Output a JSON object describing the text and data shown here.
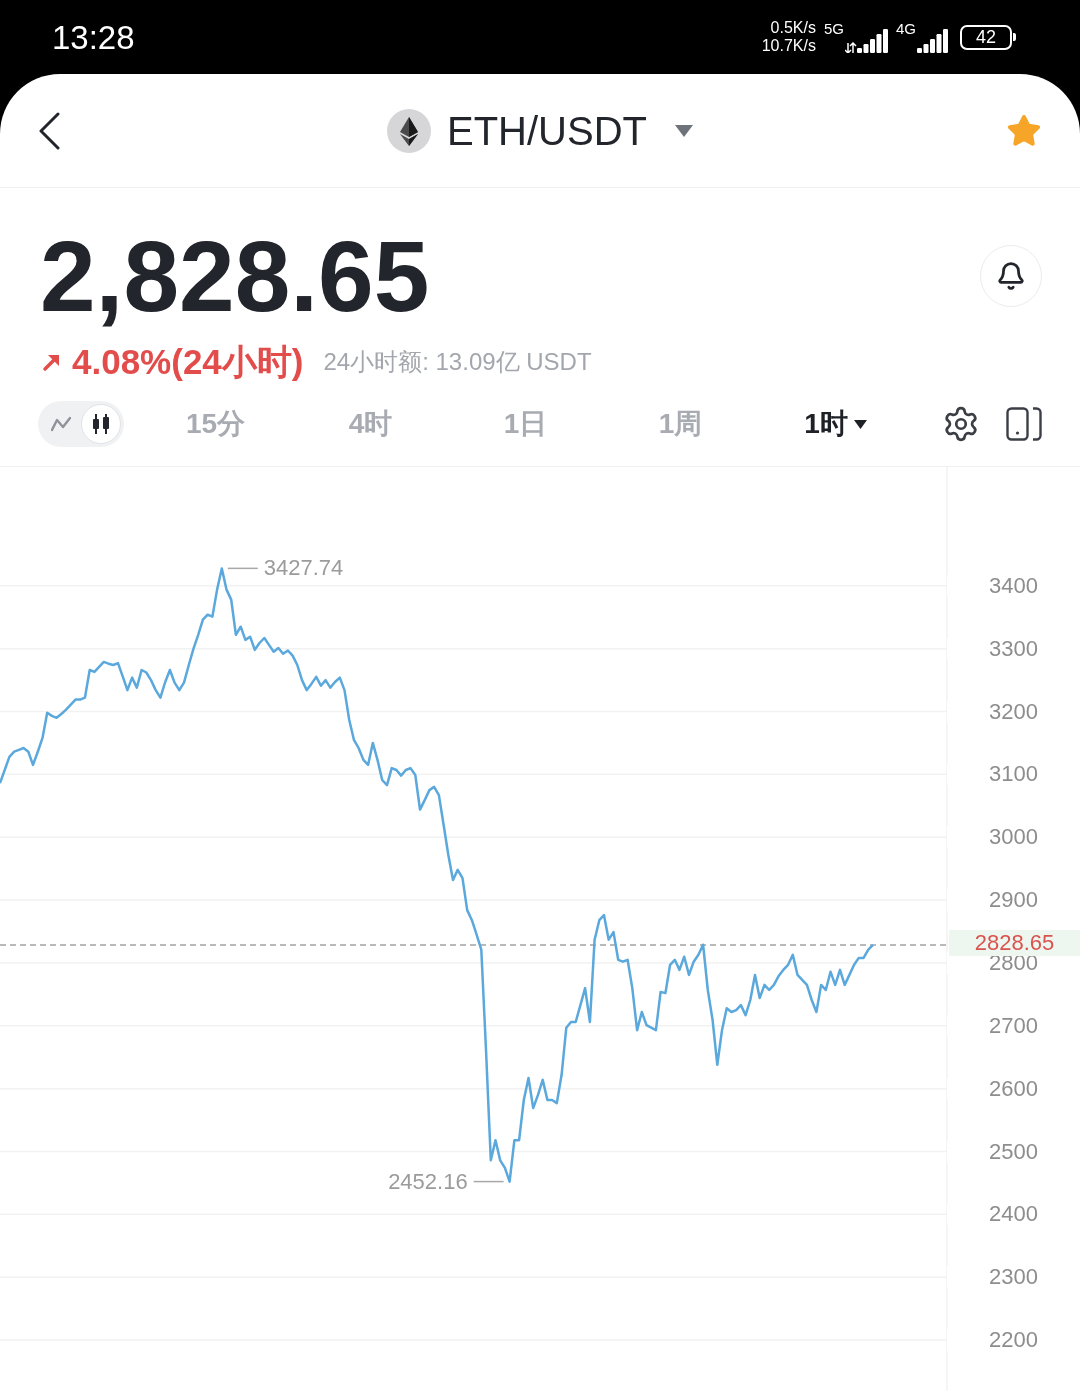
{
  "status_bar": {
    "time": "13:28",
    "network_speed": [
      "0.5K/s",
      "10.7K/s"
    ],
    "networks": [
      {
        "label": "5G",
        "data_activity": true
      },
      {
        "label": "4G",
        "data_activity": false
      }
    ],
    "battery": "42"
  },
  "header": {
    "pair": "ETH/USDT",
    "favorite": true
  },
  "ticker": {
    "price": "2,828.65",
    "rising": true,
    "change": "4.08%(24小时)",
    "volume": "24小时额: 13.09亿 USDT"
  },
  "chart_types": [
    {
      "kind": "line",
      "selected": false
    },
    {
      "kind": "candle",
      "selected": true
    }
  ],
  "intervals": [
    {
      "label": "15分",
      "selected": false,
      "dropdown": false
    },
    {
      "label": "4时",
      "selected": false,
      "dropdown": false
    },
    {
      "label": "1日",
      "selected": false,
      "dropdown": false
    },
    {
      "label": "1周",
      "selected": false,
      "dropdown": false
    },
    {
      "label": "1时",
      "selected": true,
      "dropdown": true
    }
  ],
  "chart": {
    "extremes": [
      {
        "kind": "max",
        "label": "3427.74"
      },
      {
        "kind": "min",
        "label": "2452.16"
      }
    ],
    "chart_data": {
      "type": "line",
      "ylim": [
        2119,
        3589
      ],
      "yticks": [
        3400,
        3300,
        3200,
        3100,
        3000,
        2900,
        2800,
        2700,
        2600,
        2500,
        2400,
        2300,
        2200
      ],
      "grid": true,
      "series": [
        {
          "color": "#5aa8dc",
          "values": [
            3086,
            3107,
            3128,
            3136,
            3139,
            3142,
            3136,
            3115,
            3136,
            3158,
            3198,
            3193,
            3190,
            3196,
            3203,
            3211,
            3219,
            3219,
            3222,
            3266,
            3263,
            3271,
            3279,
            3276,
            3274,
            3277,
            3256,
            3234,
            3254,
            3238,
            3266,
            3262,
            3250,
            3234,
            3222,
            3247,
            3266,
            3246,
            3234,
            3246,
            3274,
            3300,
            3322,
            3346,
            3354,
            3351,
            3394,
            3427.74,
            3394,
            3378,
            3322,
            3335,
            3314,
            3319,
            3298,
            3309,
            3317,
            3306,
            3295,
            3301,
            3292,
            3297,
            3289,
            3274,
            3250,
            3234,
            3244,
            3255,
            3241,
            3250,
            3238,
            3247,
            3254,
            3234,
            3187,
            3155,
            3142,
            3123,
            3115,
            3150,
            3123,
            3091,
            3083,
            3110,
            3107,
            3098,
            3107,
            3110,
            3099,
            3044,
            3059,
            3075,
            3080,
            3067,
            3020,
            2972,
            2932,
            2948,
            2935,
            2884,
            2868,
            2845,
            2821,
            2662,
            2486,
            2518,
            2486,
            2474,
            2452.16,
            2518,
            2518,
            2582,
            2617,
            2569,
            2590,
            2614,
            2582,
            2582,
            2577,
            2622,
            2697,
            2706,
            2706,
            2733,
            2760,
            2706,
            2837,
            2868,
            2876,
            2837,
            2849,
            2805,
            2802,
            2805,
            2760,
            2693,
            2722,
            2701,
            2697,
            2693,
            2754,
            2752,
            2797,
            2805,
            2789,
            2810,
            2781,
            2802,
            2813,
            2829,
            2757,
            2709,
            2638,
            2693,
            2728,
            2722,
            2725,
            2733,
            2717,
            2741,
            2781,
            2744,
            2765,
            2757,
            2765,
            2779,
            2789,
            2797,
            2813,
            2781,
            2773,
            2765,
            2741,
            2722,
            2765,
            2757,
            2786,
            2765,
            2789,
            2765,
            2781,
            2797,
            2808,
            2808,
            2821,
            2828.65
          ]
        }
      ],
      "ref_lines": [
        {
          "axis": "y",
          "value": 2828.65,
          "label": "2828.65"
        }
      ]
    }
  }
}
